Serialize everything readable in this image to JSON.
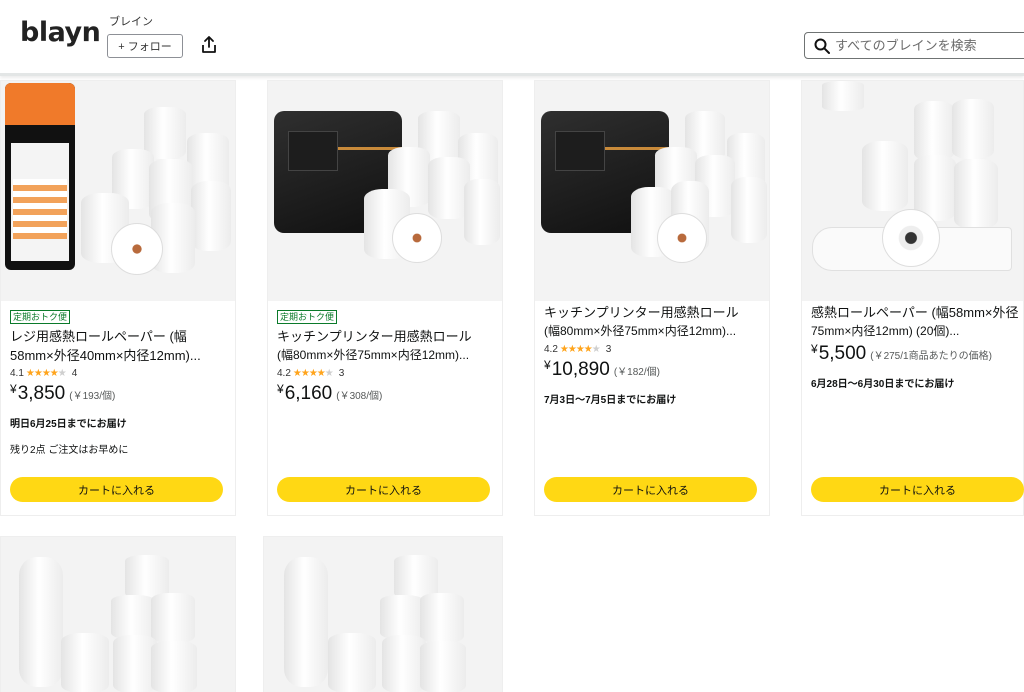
{
  "header": {
    "logo": "blayn",
    "brand_label": "ブレイン",
    "follow_label": "+ フォロー",
    "search_placeholder": "すべてのブレインを検索"
  },
  "products": [
    {
      "badge": "定期おトク便",
      "title_line1": "レジ用感熱ロールペーパー (幅",
      "title_line2": "58mm×外径40mm×内径12mm)...",
      "rating": "4.1",
      "stars": 4,
      "reviews": "4",
      "yen": "¥",
      "price": "3,850",
      "unit_price": "(￥193/個)",
      "delivery": "明日6月25日までにお届け",
      "stock": "残り2点 ご注文はお早めに",
      "cart_label": "カートに入れる"
    },
    {
      "badge": "定期おトク便",
      "title_line1": "キッチンプリンター用感熱ロール",
      "title_line2": "(幅80mm×外径75mm×内径12mm)...",
      "rating": "4.2",
      "stars": 4,
      "reviews": "3",
      "yen": "¥",
      "price": "6,160",
      "unit_price": "(￥308/個)",
      "delivery": "",
      "stock": "",
      "cart_label": "カートに入れる"
    },
    {
      "badge": "",
      "title_line1": "キッチンプリンター用感熱ロール",
      "title_line2": "(幅80mm×外径75mm×内径12mm)...",
      "rating": "4.2",
      "stars": 4,
      "reviews": "3",
      "yen": "¥",
      "price": "10,890",
      "unit_price": "(￥182/個)",
      "delivery": "7月3日～7月5日までにお届け",
      "stock": "",
      "cart_label": "カートに入れる"
    },
    {
      "badge": "",
      "title_line1": "感熱ロールペーパー (幅58mm×外径",
      "title_line2": "75mm×内径12mm) (20個)...",
      "rating": "",
      "stars": 0,
      "reviews": "",
      "yen": "¥",
      "price": "5,500",
      "unit_price": "(￥275/1商品あたりの価格)",
      "delivery": "6月28日～6月30日までにお届け",
      "stock": "",
      "cart_label": "カートに入れる"
    }
  ],
  "colors": {
    "cart_button": "#ffd814",
    "star": "#ffa41c",
    "badge": "#0a7a2a"
  }
}
